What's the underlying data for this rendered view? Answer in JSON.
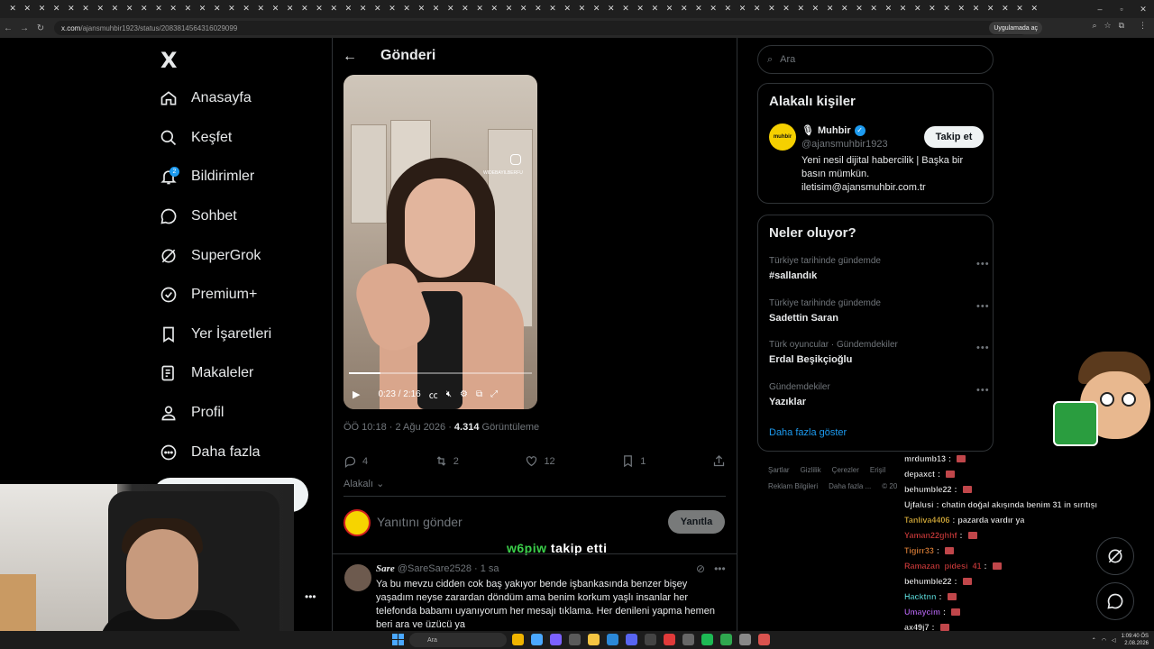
{
  "browser": {
    "url_host": "x.com",
    "url_path": "/ajansmuhbir1923/status/2083814564316029099",
    "app_button": "Uygulamada aç"
  },
  "nav": {
    "logo": "X",
    "items": [
      {
        "label": "Anasayfa",
        "icon": "home-icon"
      },
      {
        "label": "Keşfet",
        "icon": "search-icon"
      },
      {
        "label": "Bildirimler",
        "icon": "bell-icon",
        "badge": "2"
      },
      {
        "label": "Sohbet",
        "icon": "chat-icon"
      },
      {
        "label": "SuperGrok",
        "icon": "grok-icon"
      },
      {
        "label": "Premium+",
        "icon": "premium-icon"
      },
      {
        "label": "Yer İşaretleri",
        "icon": "bookmark-icon"
      },
      {
        "label": "Makaleler",
        "icon": "article-icon"
      },
      {
        "label": "Profil",
        "icon": "profile-icon"
      },
      {
        "label": "Daha fazla",
        "icon": "more-icon"
      }
    ],
    "more_dots": "•••"
  },
  "post": {
    "page_title": "Gönderi",
    "video": {
      "time": "0:23 / 2:16",
      "progress": 0.17,
      "watermark": "WIDEBAYILBERFU"
    },
    "meta_time": "ÖÖ 10:18 · 2 Ağu 2026 · ",
    "meta_views": "4.314",
    "meta_views_label": " Görüntüleme",
    "replies": "4",
    "reposts": "2",
    "likes": "12",
    "bookmarks": "1",
    "related": "Alakalı",
    "reply_placeholder": "Yanıtını gönder",
    "reply_button": "Yanıtla"
  },
  "stream_overlay": {
    "follow_name": "w6piw",
    "follow_text": " takip etti"
  },
  "reply_tweet": {
    "name": "Sare",
    "handle": "@SareSare2528 · 1 sa",
    "text": "Ya bu mevzu cidden cok baş yakıyor bende işbankasında benzer bişey yaşadım neyse zarardan döndüm ama benim korkum yaşlı insanlar her telefonda babamı uyanıyorum her mesajı tıklama.  Her denileni yapma hemen beri ara ve üzücü ya"
  },
  "right": {
    "search_placeholder": "Ara",
    "relevant_title": "Alakalı kişiler",
    "relevant_person": {
      "name": "Muhbir",
      "handle": "@ajansmuhbir1923",
      "avatar_text": "muhbir",
      "follow_label": "Takip et",
      "bio": "Yeni nesil dijital habercilik | Başka bir basın mümkün. iletisim@ajansmuhbir.com.tr"
    },
    "trends_title": "Neler oluyor?",
    "trends": [
      {
        "context": "Türkiye tarihinde gündemde",
        "title": "#sallandık"
      },
      {
        "context": "Türkiye tarihinde gündemde",
        "title": "Sadettin Saran"
      },
      {
        "context": "Türk oyuncular · Gündemdekiler",
        "title": "Erdal Beşikçioğlu"
      },
      {
        "context": "Gündemdekiler",
        "title": "Yazıklar"
      }
    ],
    "show_more": "Daha fazla göster",
    "footer": [
      "Şartlar",
      "Gizlilik",
      "Çerezler",
      "Erişil",
      "Reklam Bilgileri",
      "Daha fazla ...",
      "© 20"
    ]
  },
  "chat": [
    {
      "user": "mrdumb13",
      "color": "#ffffff",
      "msg": ""
    },
    {
      "user": "depaxct",
      "color": "#ffffff",
      "msg": ""
    },
    {
      "user": "behumble22",
      "color": "#ffffff",
      "msg": ""
    },
    {
      "user": "Ujfalusi",
      "color": "#ffffff",
      "msg": "chatin doğal akışında benim 31 in sırıtışı"
    },
    {
      "user": "Tanliva4406",
      "color": "#f5c542",
      "msg": "pazarda vardır ya"
    },
    {
      "user": "Yaman22ghhf",
      "color": "#e04040",
      "msg": ""
    },
    {
      "user": "Tigirr33",
      "color": "#f08a3c",
      "msg": ""
    },
    {
      "user": "Ramazan_pidesi_41",
      "color": "#e04040",
      "msg": ""
    },
    {
      "user": "behumble22",
      "color": "#ffffff",
      "msg": ""
    },
    {
      "user": "Hacktnn",
      "color": "#5ee0e0",
      "msg": ""
    },
    {
      "user": "Umaycim",
      "color": "#c06bff",
      "msg": ""
    },
    {
      "user": "ax49j7",
      "color": "#ffffff",
      "msg": ""
    }
  ],
  "taskbar": {
    "search": "Ara",
    "time": "1:09:40 ÖS",
    "date": "2.08.2026"
  }
}
